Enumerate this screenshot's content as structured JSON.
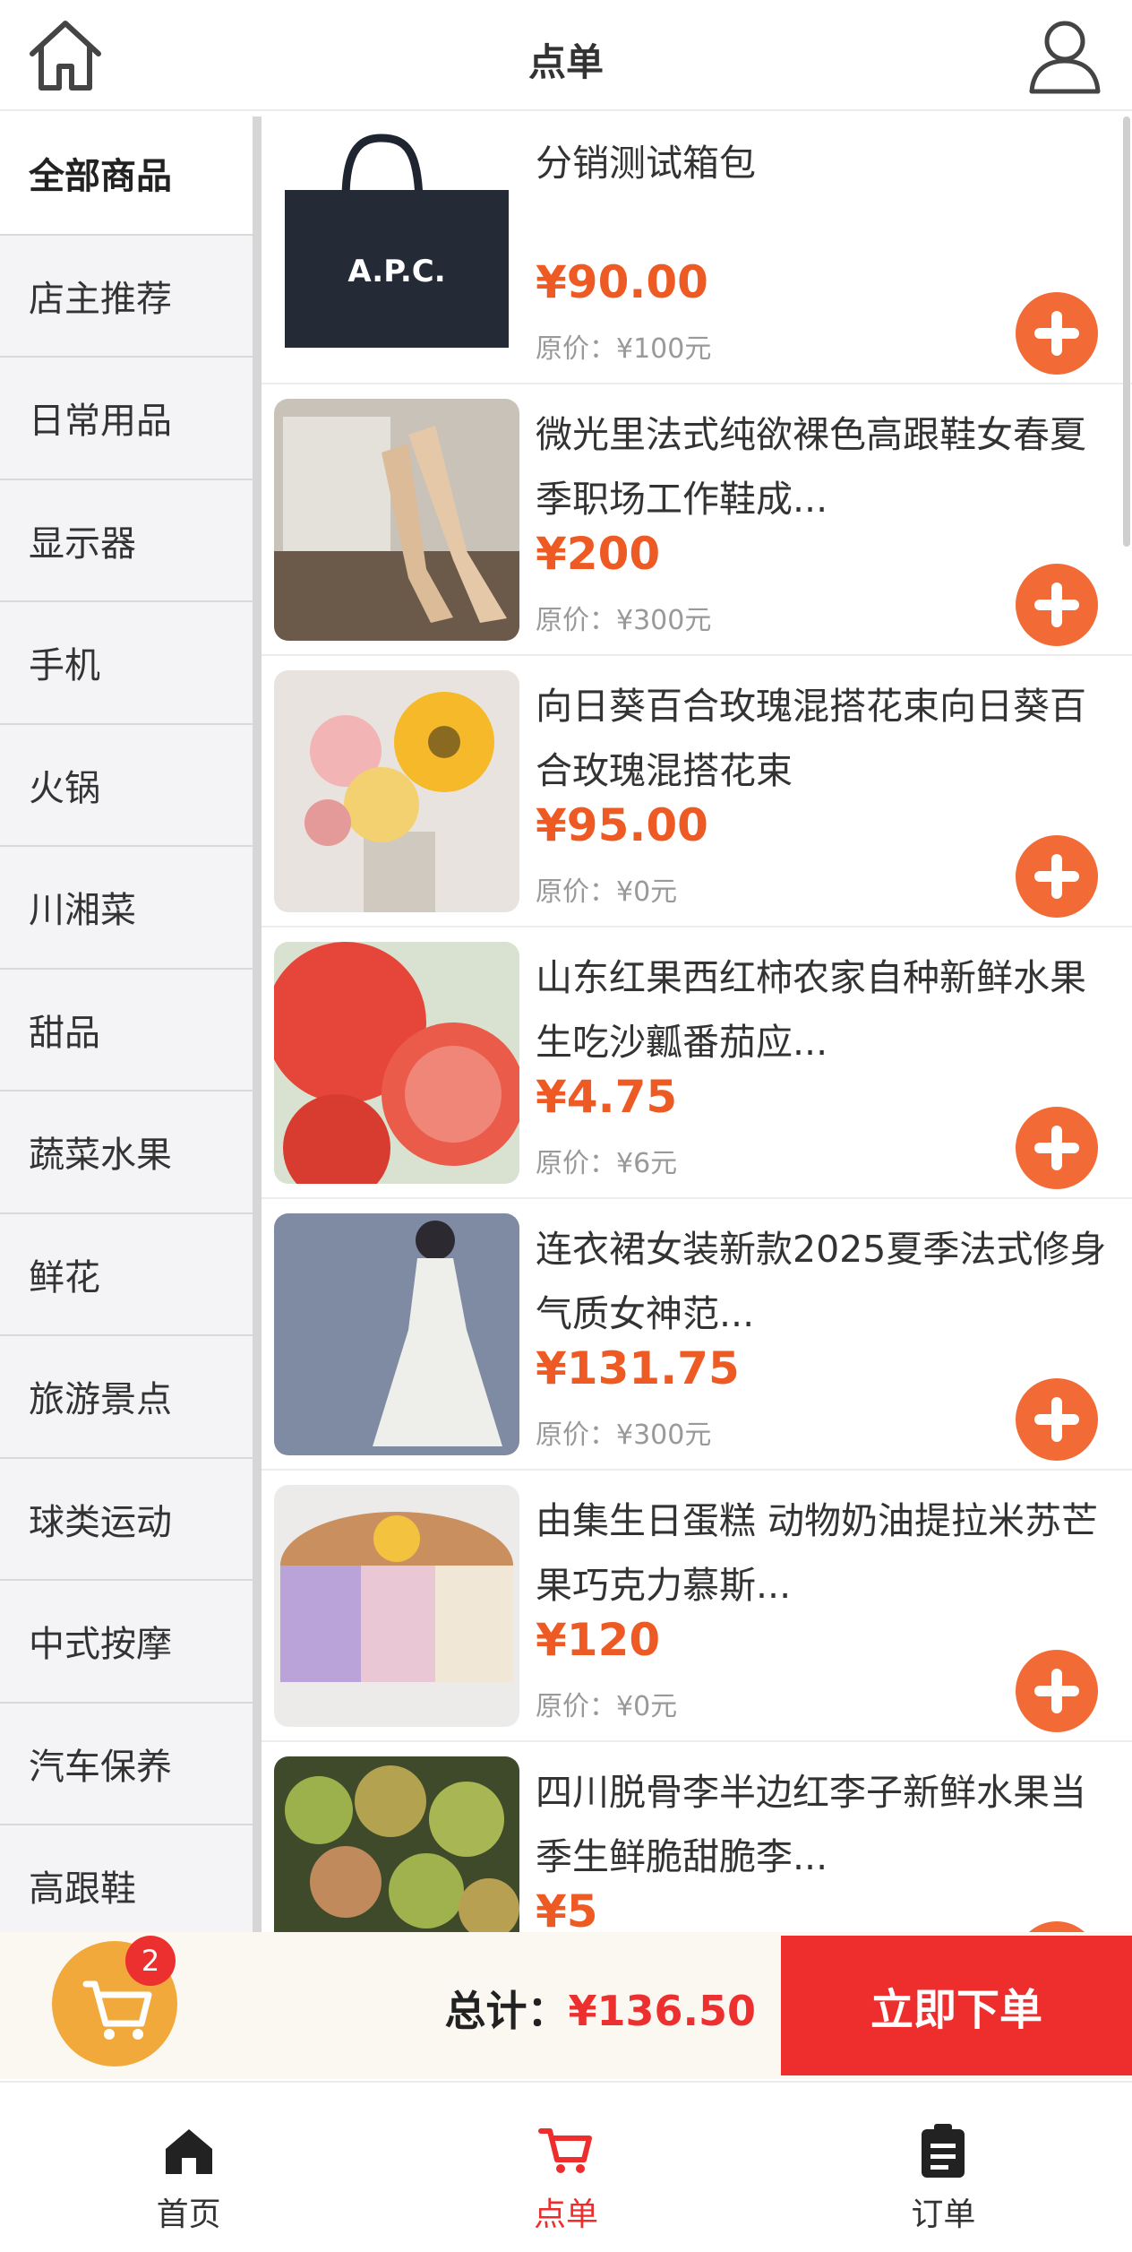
{
  "header": {
    "title": "点单",
    "home_icon": "home-icon",
    "user_icon": "user-icon"
  },
  "sidebar": {
    "items": [
      {
        "label": "全部商品",
        "active": true
      },
      {
        "label": "店主推荐"
      },
      {
        "label": "日常用品"
      },
      {
        "label": "显示器"
      },
      {
        "label": "手机"
      },
      {
        "label": "火锅"
      },
      {
        "label": "川湘菜"
      },
      {
        "label": "甜品"
      },
      {
        "label": "蔬菜水果"
      },
      {
        "label": "鲜花"
      },
      {
        "label": "旅游景点"
      },
      {
        "label": "球类运动"
      },
      {
        "label": "中式按摩"
      },
      {
        "label": "汽车保养"
      },
      {
        "label": "高跟鞋"
      }
    ]
  },
  "products": [
    {
      "name": "分销测试箱包",
      "price": "¥90.00",
      "original": "原价：¥100元",
      "image": "tote-bag"
    },
    {
      "name": "微光里法式纯欲裸色高跟鞋女春夏季职场工作鞋成...",
      "price": "¥200",
      "original": "原价：¥300元",
      "image": "high-heels"
    },
    {
      "name": "向日葵百合玫瑰混搭花束向日葵百合玫瑰混搭花束",
      "price": "¥95.00",
      "original": "原价：¥0元",
      "image": "flower-bouquet"
    },
    {
      "name": "山东红果西红柿农家自种新鲜水果生吃沙瓤番茄应...",
      "price": "¥4.75",
      "original": "原价：¥6元",
      "image": "tomatoes"
    },
    {
      "name": "连衣裙女装新款2025夏季法式修身气质女神范...",
      "price": "¥131.75",
      "original": "原价：¥300元",
      "image": "dress"
    },
    {
      "name": "由集生日蛋糕 动物奶油提拉米苏芒果巧克力慕斯...",
      "price": "¥120",
      "original": "原价：¥0元",
      "image": "cake"
    },
    {
      "name": "四川脱骨李半边红李子新鲜水果当季生鲜脆甜脆李...",
      "price": "¥5",
      "original": "",
      "image": "plums"
    }
  ],
  "cart": {
    "badge": "2",
    "total_label": "总计：",
    "total_amount": "¥136.50",
    "checkout_label": "立即下单"
  },
  "tabs": [
    {
      "label": "首页",
      "icon": "home-icon"
    },
    {
      "label": "点单",
      "icon": "cart-icon",
      "active": true
    },
    {
      "label": "订单",
      "icon": "clipboard-icon"
    }
  ],
  "colors": {
    "accent": "#ee2d2d",
    "price": "#ee5a24",
    "add_button": "#f26b36",
    "cart_button": "#f2a93b"
  }
}
